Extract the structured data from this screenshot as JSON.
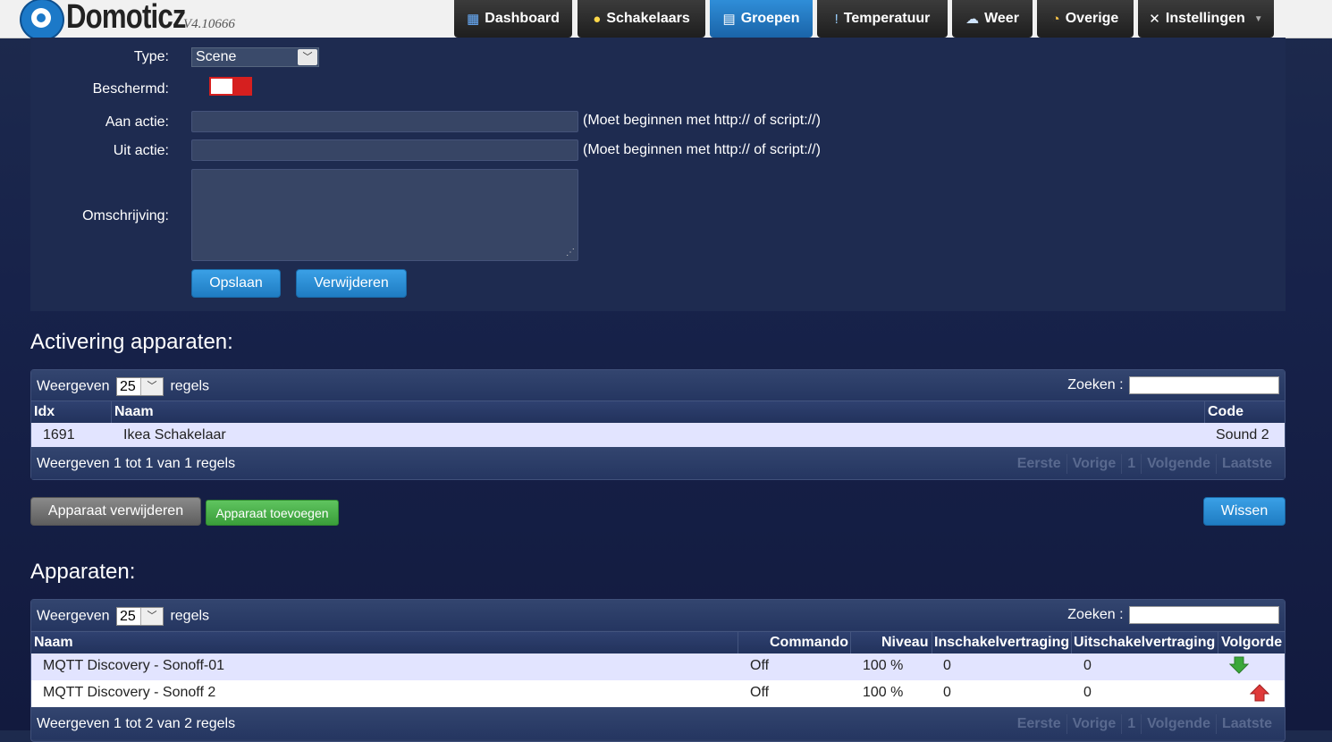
{
  "app": {
    "logo_text": "Domoticz",
    "version": "V4.10666"
  },
  "nav": [
    {
      "label": "Dashboard",
      "icon": "dashboard-icon",
      "glyph": "▦"
    },
    {
      "label": "Schakelaars",
      "icon": "lightbulb-icon",
      "glyph": "💡"
    },
    {
      "label": "Groepen",
      "icon": "scenes-icon",
      "glyph": "🎬"
    },
    {
      "label": "Temperatuur",
      "icon": "thermometer-icon",
      "glyph": "🌡"
    },
    {
      "label": "Weer",
      "icon": "weather-icon",
      "glyph": "🌧"
    },
    {
      "label": "Overige",
      "icon": "utility-icon",
      "glyph": "⚙"
    },
    {
      "label": "Instellingen",
      "icon": "settings-icon",
      "glyph": "✖"
    }
  ],
  "active_nav": "Groepen",
  "form": {
    "type_label": "Type:",
    "type_value": "Scene",
    "protected_label": "Beschermd:",
    "on_action_label": "Aan actie:",
    "off_action_label": "Uit actie:",
    "action_hint": "(Moet beginnen met http:// of script://)",
    "description_label": "Omschrijving:",
    "save_label": "Opslaan",
    "delete_label": "Verwijderen"
  },
  "activation": {
    "title": "Activering apparaten:",
    "show_prefix": "Weergeven",
    "page_length": "25",
    "show_suffix": "regels",
    "search_label": "Zoeken :",
    "columns": [
      "Idx",
      "Naam",
      "Code"
    ],
    "rows": [
      {
        "idx": "1691",
        "name": "Ikea Schakelaar",
        "code": "Sound 2"
      }
    ],
    "info": "Weergeven 1 tot 1 van 1 regels",
    "pager": [
      "Eerste",
      "Vorige",
      "1",
      "Volgende",
      "Laatste"
    ],
    "remove_label": "Apparaat verwijderen",
    "add_label": "Apparaat toevoegen",
    "clear_label": "Wissen"
  },
  "devices": {
    "title": "Apparaten:",
    "show_prefix": "Weergeven",
    "page_length": "25",
    "show_suffix": "regels",
    "search_label": "Zoeken :",
    "columns": [
      "Naam",
      "Commando",
      "Niveau",
      "Inschakelvertraging",
      "Uitschakelvertraging",
      "Volgorde"
    ],
    "rows": [
      {
        "name": "MQTT Discovery - Sonoff-01",
        "command": "Off",
        "level": "100 %",
        "on_delay": "0",
        "off_delay": "0",
        "order": "down-arrow-icon"
      },
      {
        "name": "MQTT Discovery - Sonoff 2",
        "command": "Off",
        "level": "100 %",
        "on_delay": "0",
        "off_delay": "0",
        "order": "up-arrow-icon"
      }
    ],
    "info": "Weergeven 1 tot 2 van 2 regels",
    "pager": [
      "Eerste",
      "Vorige",
      "1",
      "Volgende",
      "Laatste"
    ]
  },
  "colors": {
    "accent": "#1f7cc2",
    "toggle_off": "#d61f1f",
    "add_green": "#3a9e3a",
    "arrow_down": "#3aa83a",
    "arrow_up": "#e03a3a"
  }
}
